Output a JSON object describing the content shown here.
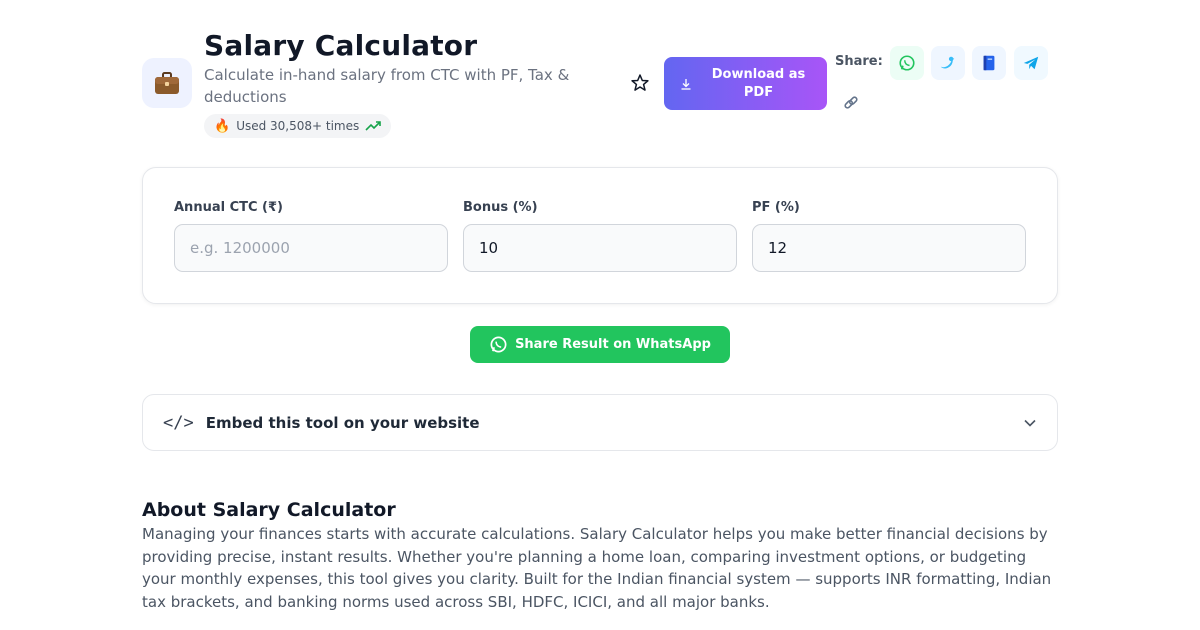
{
  "header": {
    "title": "Salary Calculator",
    "subtitle": "Calculate in-hand salary from CTC with PF, Tax & deductions",
    "usage_fire": "🔥",
    "usage_text": "Used 30,508+ times",
    "app_icon": "briefcase-icon",
    "favorite_icon": "star-outline-icon",
    "download_label": "Download as PDF",
    "share_label": "Share:",
    "share_icons": [
      "whatsapp-icon",
      "twitter-icon",
      "facebook-icon",
      "telegram-icon",
      "link-icon"
    ]
  },
  "form": {
    "fields": [
      {
        "label": "Annual CTC (₹)",
        "value": "",
        "placeholder": "e.g. 1200000"
      },
      {
        "label": "Bonus (%)",
        "value": "10",
        "placeholder": ""
      },
      {
        "label": "PF (%)",
        "value": "12",
        "placeholder": ""
      }
    ]
  },
  "whatsapp_share": {
    "label": "Share Result on WhatsApp"
  },
  "embed": {
    "icon": "</>",
    "title": "Embed this tool on your website"
  },
  "about": {
    "heading": "About Salary Calculator",
    "body": "Managing your finances starts with accurate calculations. Salary Calculator helps you make better financial decisions by providing precise, instant results. Whether you're planning a home loan, comparing investment options, or budgeting your monthly expenses, this tool gives you clarity. Built for the Indian financial system — supports INR formatting, Indian tax brackets, and banking norms used across SBI, HDFC, ICICI, and all major banks."
  },
  "colors": {
    "accent_gradient_start": "#6366f1",
    "accent_gradient_end": "#a855f7",
    "whatsapp_green": "#22c55e"
  }
}
